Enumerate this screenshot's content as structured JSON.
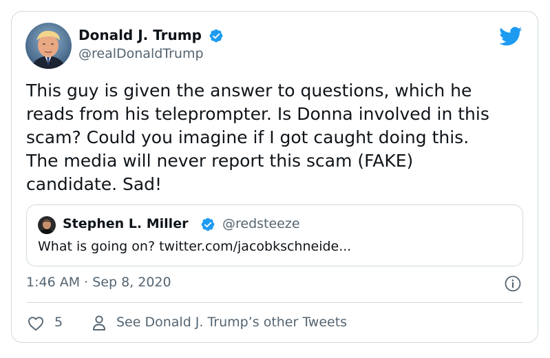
{
  "tweet": {
    "author": {
      "name": "Donald J. Trump",
      "handle": "@realDonaldTrump",
      "verified": true
    },
    "text": "This guy is given the answer to questions, which he\nreads from his teleprompter. Is Donna  involved in this\nscam? Could you imagine if I got caught doing this.\nThe media will never report this scam (FAKE)\ncandidate. Sad!",
    "quoted_tweet": {
      "name": "Stephen L. Miller",
      "handle": "@redsteeze",
      "verified": true,
      "text": "What is going on? twitter.com/jacobkschneide..."
    },
    "timestamp": "1:46 AM · Sep 8, 2020",
    "like_count": "5",
    "other_tweets_link": "See Donald J. Trump’s other Tweets"
  },
  "icons": {
    "brand": "twitter-bird-icon",
    "verified": "verified-badge-icon",
    "info": "info-icon",
    "like": "heart-icon",
    "profile": "person-icon"
  },
  "colors": {
    "brand_blue": "#1d9bf0",
    "text_primary": "#0f1419",
    "text_secondary": "#536471",
    "border": "#cfd9de"
  }
}
